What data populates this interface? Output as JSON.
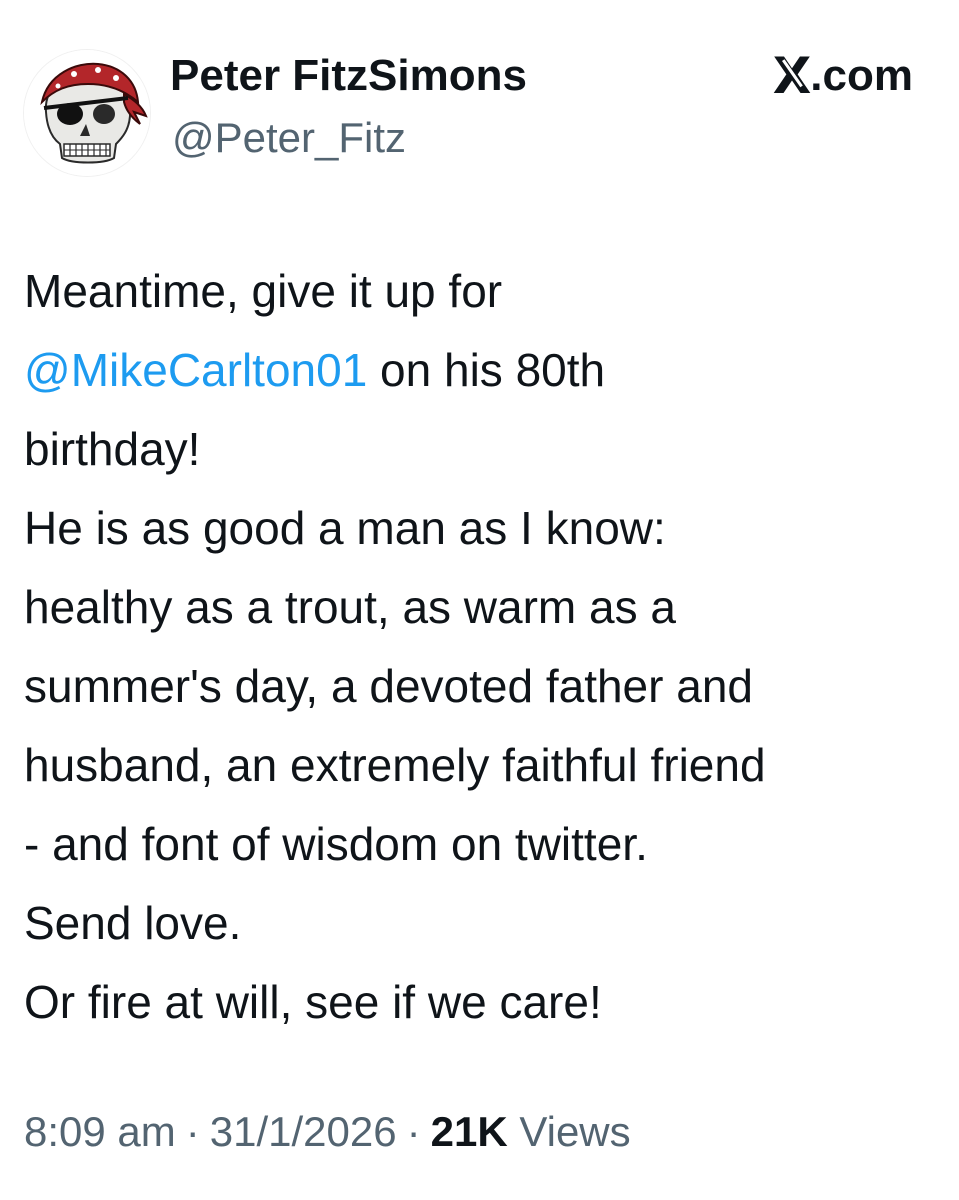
{
  "author": {
    "display_name": "Peter FitzSimons",
    "handle": "@Peter_Fitz",
    "avatar_icon": "pirate-skull-bandana-icon"
  },
  "brand": {
    "logo": "x-logo-icon",
    "domain": ".com"
  },
  "tweet": {
    "line1": "Meantime, give it up for",
    "mention": "@MikeCarlton01",
    "line2_rest": " on his 80th",
    "line3": "birthday!",
    "line4": "He is as good a man as I know:",
    "line5": "healthy as a trout, as warm as a",
    "line6": "summer's day, a devoted father and",
    "line7": "husband, an extremely faithful friend",
    "line8": "- and font of wisdom on twitter.",
    "line9": "Send love.",
    "line10": "Or fire at will, see if we care!"
  },
  "meta": {
    "time": "8:09 am",
    "date": "31/1/2026",
    "views_count": "21K",
    "views_label": "Views",
    "separator": "·"
  },
  "colors": {
    "mention": "#1d9bf0",
    "secondary_text": "#536471",
    "primary_text": "#0f1419",
    "bandana": "#b3262a"
  }
}
